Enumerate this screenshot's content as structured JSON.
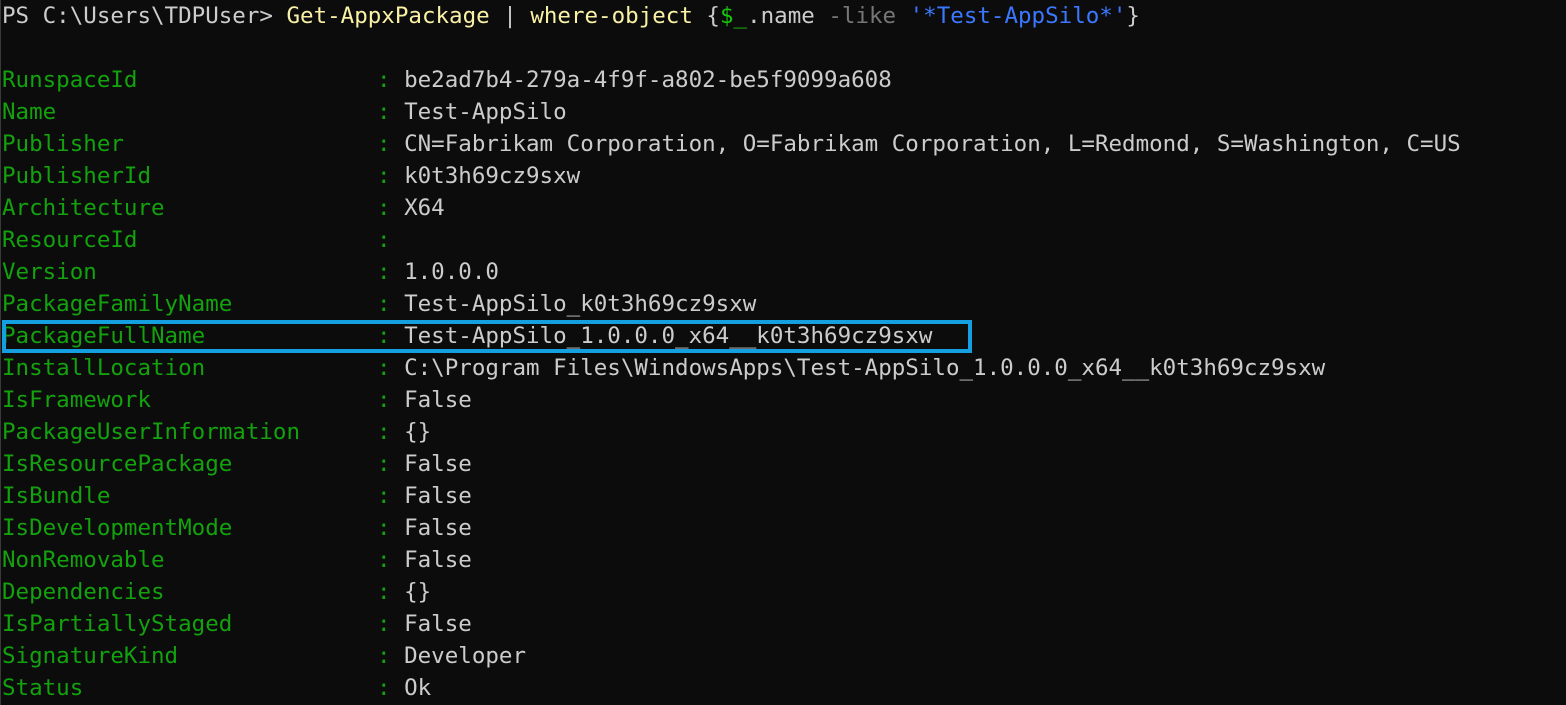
{
  "terminal": {
    "prompt": "PS C:\\Users\\TDPUser> ",
    "command": {
      "cmdlet": "Get-AppxPackage",
      "pipe": " | ",
      "filter_cmdlet": "where-object",
      "open_brace": " {",
      "variable": "$_",
      "property": ".name ",
      "operator": "-like",
      "space": " ",
      "pattern": "'*Test-AppSilo*'",
      "close_brace": "}"
    },
    "separator": ": ",
    "highlighted_property": "PackageFullName",
    "highlight_color": "#139fe0",
    "properties": [
      {
        "key": "RunspaceId",
        "value": "be2ad7b4-279a-4f9f-a802-be5f9099a608"
      },
      {
        "key": "Name",
        "value": "Test-AppSilo"
      },
      {
        "key": "Publisher",
        "value": "CN=Fabrikam Corporation, O=Fabrikam Corporation, L=Redmond, S=Washington, C=US"
      },
      {
        "key": "PublisherId",
        "value": "k0t3h69cz9sxw"
      },
      {
        "key": "Architecture",
        "value": "X64"
      },
      {
        "key": "ResourceId",
        "value": ""
      },
      {
        "key": "Version",
        "value": "1.0.0.0"
      },
      {
        "key": "PackageFamilyName",
        "value": "Test-AppSilo_k0t3h69cz9sxw"
      },
      {
        "key": "PackageFullName",
        "value": "Test-AppSilo_1.0.0.0_x64__k0t3h69cz9sxw"
      },
      {
        "key": "InstallLocation",
        "value": "C:\\Program Files\\WindowsApps\\Test-AppSilo_1.0.0.0_x64__k0t3h69cz9sxw"
      },
      {
        "key": "IsFramework",
        "value": "False"
      },
      {
        "key": "PackageUserInformation",
        "value": "{}"
      },
      {
        "key": "IsResourcePackage",
        "value": "False"
      },
      {
        "key": "IsBundle",
        "value": "False"
      },
      {
        "key": "IsDevelopmentMode",
        "value": "False"
      },
      {
        "key": "NonRemovable",
        "value": "False"
      },
      {
        "key": "Dependencies",
        "value": "{}"
      },
      {
        "key": "IsPartiallyStaged",
        "value": "False"
      },
      {
        "key": "SignatureKind",
        "value": "Developer"
      },
      {
        "key": "Status",
        "value": "Ok"
      }
    ]
  }
}
